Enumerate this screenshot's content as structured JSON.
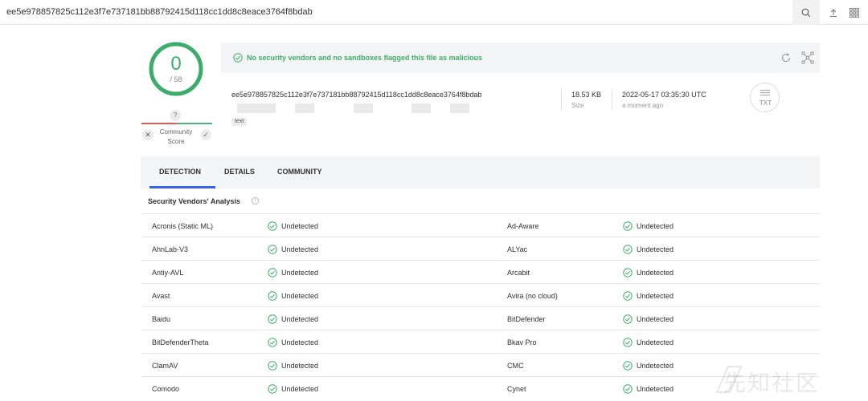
{
  "search": {
    "query": "ee5e978857825c112e3f7e737181bb88792415d118cc1dd8c8eace3764f8bdab"
  },
  "score": {
    "detections": "0",
    "total": "/ 58",
    "question": "?",
    "community_label_1": "Community",
    "community_label_2": "Score"
  },
  "banner": {
    "message": "No security vendors and no sandboxes flagged this file as malicious"
  },
  "file": {
    "hash": "ee5e978857825c112e3f7e737181bb88792415d118cc1dd8c8eace3764f8bdab",
    "tag": "text",
    "size_value": "18.53 KB",
    "size_label": "Size",
    "date_value": "2022-05-17 03:35:30 UTC",
    "date_label": "a moment ago",
    "type_label": "TXT"
  },
  "tabs": {
    "detection": "DETECTION",
    "details": "DETAILS",
    "community": "COMMUNITY"
  },
  "analysis": {
    "heading": "Security Vendors' Analysis",
    "rows": [
      {
        "left_name": "Acronis (Static ML)",
        "left_status": "Undetected",
        "right_name": "Ad-Aware",
        "right_status": "Undetected"
      },
      {
        "left_name": "AhnLab-V3",
        "left_status": "Undetected",
        "right_name": "ALYac",
        "right_status": "Undetected"
      },
      {
        "left_name": "Antiy-AVL",
        "left_status": "Undetected",
        "right_name": "Arcabit",
        "right_status": "Undetected"
      },
      {
        "left_name": "Avast",
        "left_status": "Undetected",
        "right_name": "Avira (no cloud)",
        "right_status": "Undetected"
      },
      {
        "left_name": "Baidu",
        "left_status": "Undetected",
        "right_name": "BitDefender",
        "right_status": "Undetected"
      },
      {
        "left_name": "BitDefenderTheta",
        "left_status": "Undetected",
        "right_name": "Bkav Pro",
        "right_status": "Undetected"
      },
      {
        "left_name": "ClamAV",
        "left_status": "Undetected",
        "right_name": "CMC",
        "right_status": "Undetected"
      },
      {
        "left_name": "Comodo",
        "left_status": "Undetected",
        "right_name": "Cynet",
        "right_status": "Undetected"
      }
    ]
  },
  "watermark": {
    "text": "先知社区"
  },
  "colors": {
    "clean_green": "#3dac6a",
    "tab_accent": "#3b61e7",
    "malicious_red": "#e55a5a"
  },
  "icons": [
    "search-icon",
    "upload-icon",
    "apps-grid-icon",
    "check-circle-icon",
    "refresh-icon",
    "graph-icon",
    "txt-file-icon",
    "info-icon",
    "thumbs-down-icon",
    "thumbs-up-icon"
  ]
}
